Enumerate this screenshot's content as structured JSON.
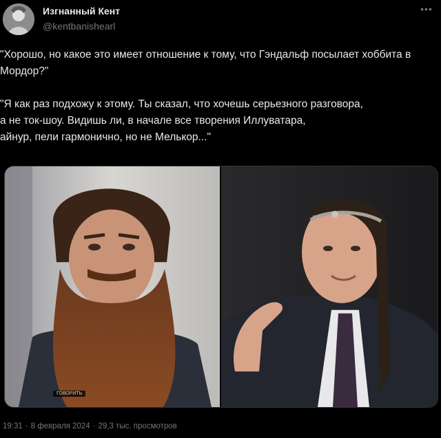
{
  "author": {
    "display_name": "Изгнанный Кент",
    "handle": "@kentbanishearl",
    "avatar_icon": "avatar-portrait-icon"
  },
  "more_icon": "more-options-icon",
  "tweet": {
    "paragraph1": "\"Хорошо, но какое это имеет отношение к тому, что Гэндальф посылает хоббита в Мордор?\"",
    "paragraph2": "\"Я как раз подхожу к этому. Ты сказал, что хочешь серьезного разговора,\nа не ток-шоу. Видишь ли, в начале все творения Иллуватара,\nайнур, пели гармонично, но не Мелькор...\""
  },
  "media": {
    "caption_badge": "ГОВОРИТЬ"
  },
  "meta": {
    "time": "19:31",
    "date": "8 февраля 2024",
    "views": "29,3 тыс. просмотров",
    "separator": "·"
  },
  "colors": {
    "background": "#000000",
    "text": "#e7e9ea",
    "secondary": "#71767b"
  }
}
